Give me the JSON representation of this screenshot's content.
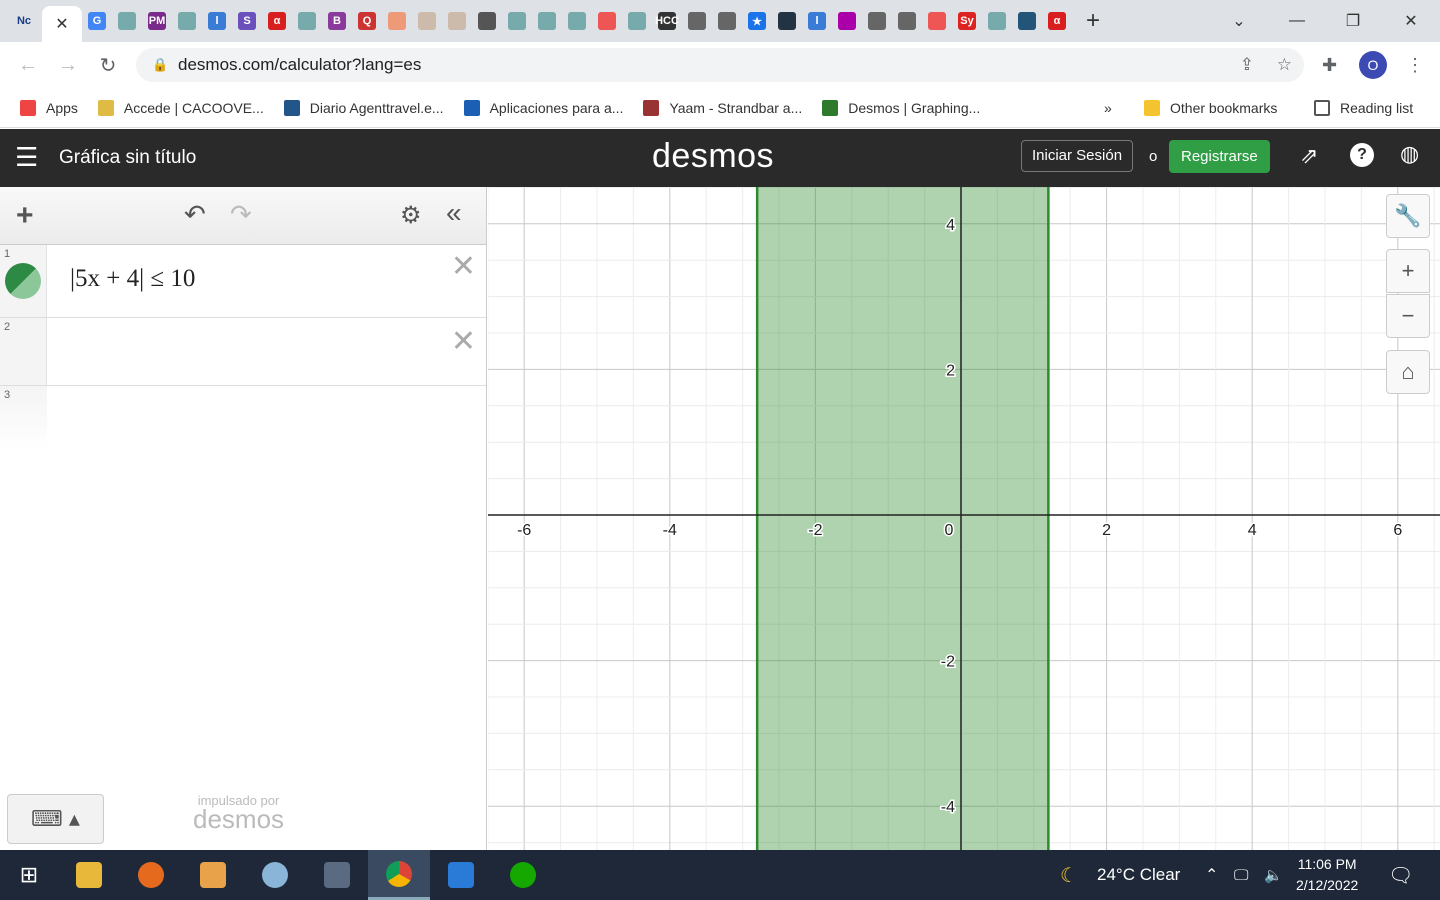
{
  "browser": {
    "active_tab_icon": "Nc",
    "tab_icons": [
      {
        "t": "G",
        "c": "#4285f4"
      },
      {
        "t": "",
        "c": "#7aa"
      },
      {
        "t": "PM",
        "c": "#7a2a8a"
      },
      {
        "t": "",
        "c": "#7aa"
      },
      {
        "t": "l",
        "c": "#3a7bd5"
      },
      {
        "t": "S",
        "c": "#6b4fbb"
      },
      {
        "t": "α",
        "c": "#d81e1e"
      },
      {
        "t": "",
        "c": "#7aa"
      },
      {
        "t": "B",
        "c": "#8a3a9a"
      },
      {
        "t": "Q",
        "c": "#c33"
      },
      {
        "t": "",
        "c": "#e97"
      },
      {
        "t": "",
        "c": "#cba"
      },
      {
        "t": "",
        "c": "#cba"
      },
      {
        "t": "",
        "c": "#555"
      },
      {
        "t": "",
        "c": "#7aa"
      },
      {
        "t": "",
        "c": "#7aa"
      },
      {
        "t": "",
        "c": "#7aa"
      },
      {
        "t": "",
        "c": "#e55"
      },
      {
        "t": "",
        "c": "#7aa"
      },
      {
        "t": "HCC",
        "c": "#333"
      },
      {
        "t": "",
        "c": "#666"
      },
      {
        "t": "",
        "c": "#666"
      },
      {
        "t": "★",
        "c": "#1a73e8"
      },
      {
        "t": "",
        "c": "#234"
      },
      {
        "t": "l",
        "c": "#3a7bd5"
      },
      {
        "t": "",
        "c": "#a0a"
      },
      {
        "t": "",
        "c": "#666"
      },
      {
        "t": "",
        "c": "#666"
      },
      {
        "t": "",
        "c": "#e55"
      },
      {
        "t": "Sy",
        "c": "#d22"
      },
      {
        "t": "",
        "c": "#7aa"
      },
      {
        "t": "",
        "c": "#257"
      },
      {
        "t": "α",
        "c": "#d81e1e"
      }
    ],
    "url": "desmos.com/calculator?lang=es",
    "bookmarks": [
      {
        "label": "Apps",
        "c": "#e44"
      },
      {
        "label": "Accede | CACOOVE...",
        "c": "#db4"
      },
      {
        "label": "Diario Agenttravel.e...",
        "c": "#258"
      },
      {
        "label": "Aplicaciones para a...",
        "c": "#1a5fb4"
      },
      {
        "label": "Yaam - Strandbar a...",
        "c": "#933"
      },
      {
        "label": "Desmos | Graphing...",
        "c": "#2d7a2d"
      }
    ],
    "more": "»",
    "other_bookmarks": "Other bookmarks",
    "reading_list": "Reading list",
    "profile": "O"
  },
  "desmos": {
    "title": "Gráfica sin título",
    "logo": "desmos",
    "login": "Iniciar Sesión",
    "or": "o",
    "register": "Registrarse",
    "expressions": [
      {
        "num": "1",
        "latex": "|5x + 4| ≤ 10"
      },
      {
        "num": "2",
        "latex": ""
      },
      {
        "num": "3",
        "latex": ""
      }
    ],
    "powered_by": "impulsado por",
    "powered_logo": "desmos",
    "accent": "#2f9e44"
  },
  "chart_data": {
    "type": "inequality",
    "expression": "|5x+4| <= 10",
    "shaded_x_range": [
      -2.8,
      1.2
    ],
    "xlim": [
      -6.5,
      6.6
    ],
    "ylim": [
      -4.6,
      4.5
    ],
    "x_ticks": [
      -6,
      -4,
      -2,
      0,
      2,
      4,
      6
    ],
    "y_ticks": [
      -4,
      -2,
      2,
      4
    ],
    "grid": true,
    "fill_color": "#2d8a2d"
  },
  "taskbar": {
    "weather": "24°C  Clear",
    "time": "11:06 PM",
    "date": "2/12/2022"
  }
}
